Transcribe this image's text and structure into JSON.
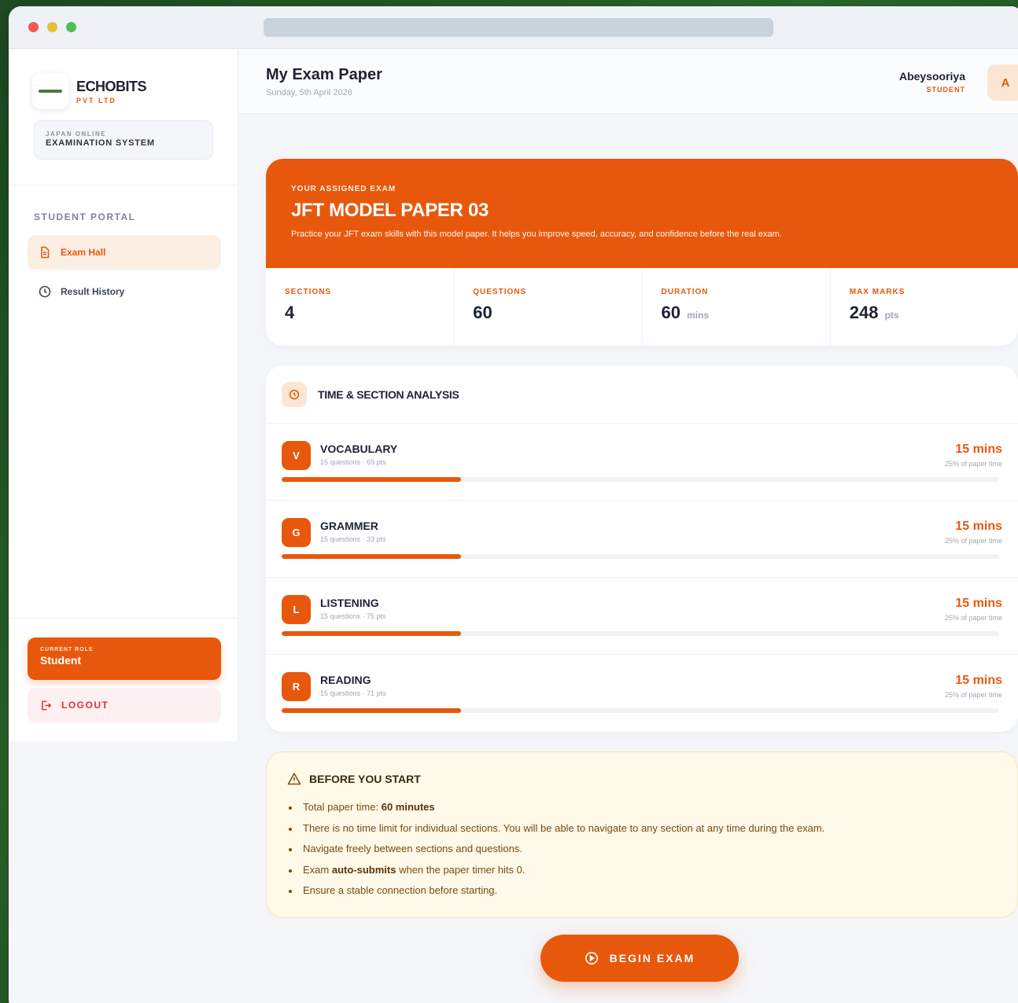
{
  "brand": {
    "name": "ECHOBITS",
    "sub": "PVT LTD"
  },
  "system": {
    "line1": "JAPAN ONLINE",
    "line2": "EXAMINATION SYSTEM"
  },
  "sidebar": {
    "section_label": "STUDENT PORTAL",
    "items": [
      {
        "label": "Exam Hall",
        "icon": "document-icon",
        "active": true
      },
      {
        "label": "Result History",
        "icon": "clock-icon",
        "active": false
      }
    ],
    "role_label": "CURRENT ROLE",
    "role_value": "Student",
    "logout_label": "LOGOUT"
  },
  "header": {
    "title": "My Exam Paper",
    "date": "Sunday, 5th April 2026",
    "user_name": "Abeysooriya",
    "user_role": "STUDENT",
    "avatar_letter": "A"
  },
  "exam": {
    "eyebrow": "YOUR ASSIGNED EXAM",
    "title": "JFT MODEL PAPER 03",
    "description": "Practice your JFT exam skills with this model paper. It helps you improve speed, accuracy, and confidence before the real exam.",
    "stats": [
      {
        "label": "SECTIONS",
        "value": "4",
        "unit": ""
      },
      {
        "label": "QUESTIONS",
        "value": "60",
        "unit": ""
      },
      {
        "label": "DURATION",
        "value": "60",
        "unit": "mins"
      },
      {
        "label": "MAX MARKS",
        "value": "248",
        "unit": "pts"
      }
    ]
  },
  "analysis": {
    "title": "TIME & SECTION ANALYSIS",
    "sections": [
      {
        "badge": "V",
        "name": "VOCABULARY",
        "meta": "15 questions · 69 pts",
        "time": "15 mins",
        "pct_label": "25% of paper time",
        "fraction": 0.25
      },
      {
        "badge": "G",
        "name": "GRAMMER",
        "meta": "15 questions · 33 pts",
        "time": "15 mins",
        "pct_label": "25% of paper time",
        "fraction": 0.25
      },
      {
        "badge": "L",
        "name": "LISTENING",
        "meta": "15 questions · 75 pts",
        "time": "15 mins",
        "pct_label": "25% of paper time",
        "fraction": 0.25
      },
      {
        "badge": "R",
        "name": "READING",
        "meta": "15 questions · 71 pts",
        "time": "15 mins",
        "pct_label": "25% of paper time",
        "fraction": 0.25
      }
    ]
  },
  "notes": {
    "title": "BEFORE YOU START",
    "item1_pre": "Total paper time: ",
    "item1_bold": "60 minutes",
    "item2": "There is no time limit for individual sections. You will be able to navigate to any section at any time during the exam.",
    "item3": "Navigate freely between sections and questions.",
    "item4_pre": "Exam ",
    "item4_bold": "auto-submits",
    "item4_post": " when the paper timer hits 0.",
    "item5": "Ensure a stable connection before starting."
  },
  "begin_label": "BEGIN EXAM",
  "colors": {
    "accent": "#e8580c",
    "note_bg": "#fef9e8",
    "logout": "#e0303c"
  }
}
